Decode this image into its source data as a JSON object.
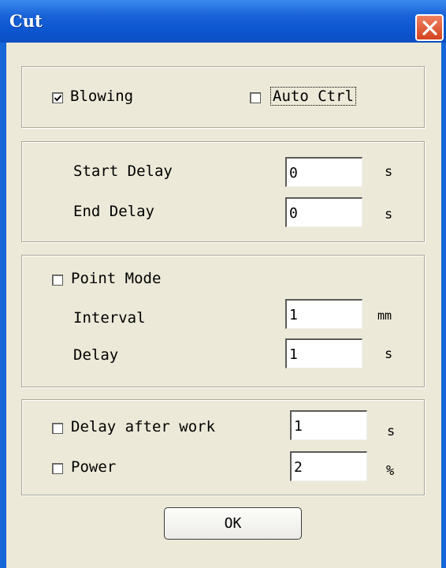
{
  "window": {
    "title": "Cut"
  },
  "group1": {
    "blowing": {
      "label": "Blowing",
      "checked": true
    },
    "auto_ctrl": {
      "label": "Auto Ctrl",
      "checked": false
    }
  },
  "group2": {
    "start_delay": {
      "label": "Start Delay",
      "value": "0",
      "unit": "s"
    },
    "end_delay": {
      "label": "End Delay",
      "value": "0",
      "unit": "s"
    }
  },
  "group3": {
    "point_mode": {
      "label": "Point Mode",
      "checked": false
    },
    "interval": {
      "label": "Interval",
      "value": "1",
      "unit": "mm"
    },
    "delay": {
      "label": "Delay",
      "value": "1",
      "unit": "s"
    }
  },
  "group4": {
    "delay_after_work": {
      "label": "Delay after work",
      "checked": false,
      "value": "1",
      "unit": "s"
    },
    "power": {
      "label": "Power",
      "checked": false,
      "value": "2",
      "unit": "%"
    }
  },
  "buttons": {
    "ok": "OK"
  },
  "colors": {
    "titlebar": "#0c56d0",
    "client_bg": "#ece9d8",
    "close_button": "#d54420"
  }
}
